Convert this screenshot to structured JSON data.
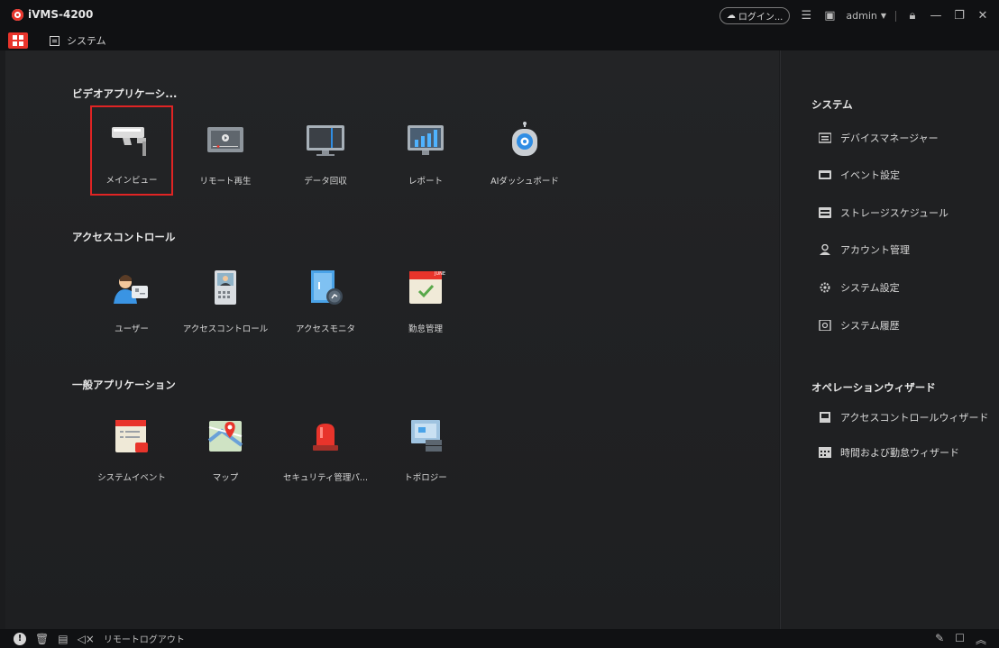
{
  "app": {
    "title": "iVMS-4200"
  },
  "topbar": {
    "login_label": "ログイン...",
    "user": "admin"
  },
  "tabs": {
    "system_label": "システム"
  },
  "sections": {
    "video": {
      "title": "ビデオアプリケーシ...",
      "items": [
        "メインビュー",
        "リモート再生",
        "データ回収",
        "レポート",
        "AIダッシュボード"
      ]
    },
    "access": {
      "title": "アクセスコントロール",
      "items": [
        "ユーザー",
        "アクセスコントロール",
        "アクセスモニタ",
        "勤怠管理"
      ]
    },
    "general": {
      "title": "一般アプリケーション",
      "items": [
        "システムイベント",
        "マップ",
        "セキュリティ管理パ...",
        "トポロジー"
      ]
    }
  },
  "calendar_badge": "JUNE",
  "side": {
    "system_title": "システム",
    "system_items": [
      "デバイスマネージャー",
      "イベント設定",
      "ストレージスケジュール",
      "アカウント管理",
      "システム設定",
      "システム履歴"
    ],
    "wizard_title": "オペレーションウィザード",
    "wizard_items": [
      "アクセスコントロールウィザード",
      "時間および勤怠ウィザード"
    ]
  },
  "statusbar": {
    "remote_logout": "リモートログアウト"
  },
  "colors": {
    "accent": "#e8342b",
    "background": "#1b1c1e"
  }
}
